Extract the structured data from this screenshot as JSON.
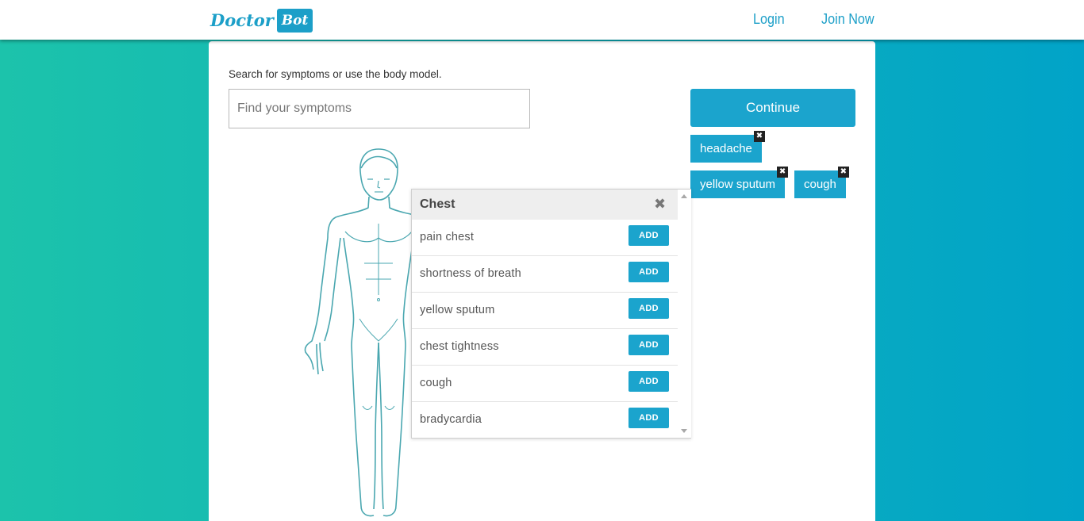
{
  "nav": {
    "logo_text": "Doctor",
    "logo_badge": "Bot",
    "login": "Login",
    "join": "Join Now"
  },
  "search": {
    "instructions": "Search for symptoms or use the body model.",
    "placeholder": "Find your symptoms"
  },
  "continue_label": "Continue",
  "selected_symptoms": [
    "headache",
    "yellow sputum",
    "cough"
  ],
  "popup": {
    "title": "Chest",
    "add_label": "ADD",
    "symptoms": [
      "pain chest",
      "shortness of breath",
      "yellow sputum",
      "chest tightness",
      "cough",
      "bradycardia"
    ]
  },
  "colors": {
    "accent": "#1ba4cd",
    "background_start": "#1cc3ab",
    "background_end": "#01a3c8",
    "body_outline": "#4aa7b0"
  }
}
